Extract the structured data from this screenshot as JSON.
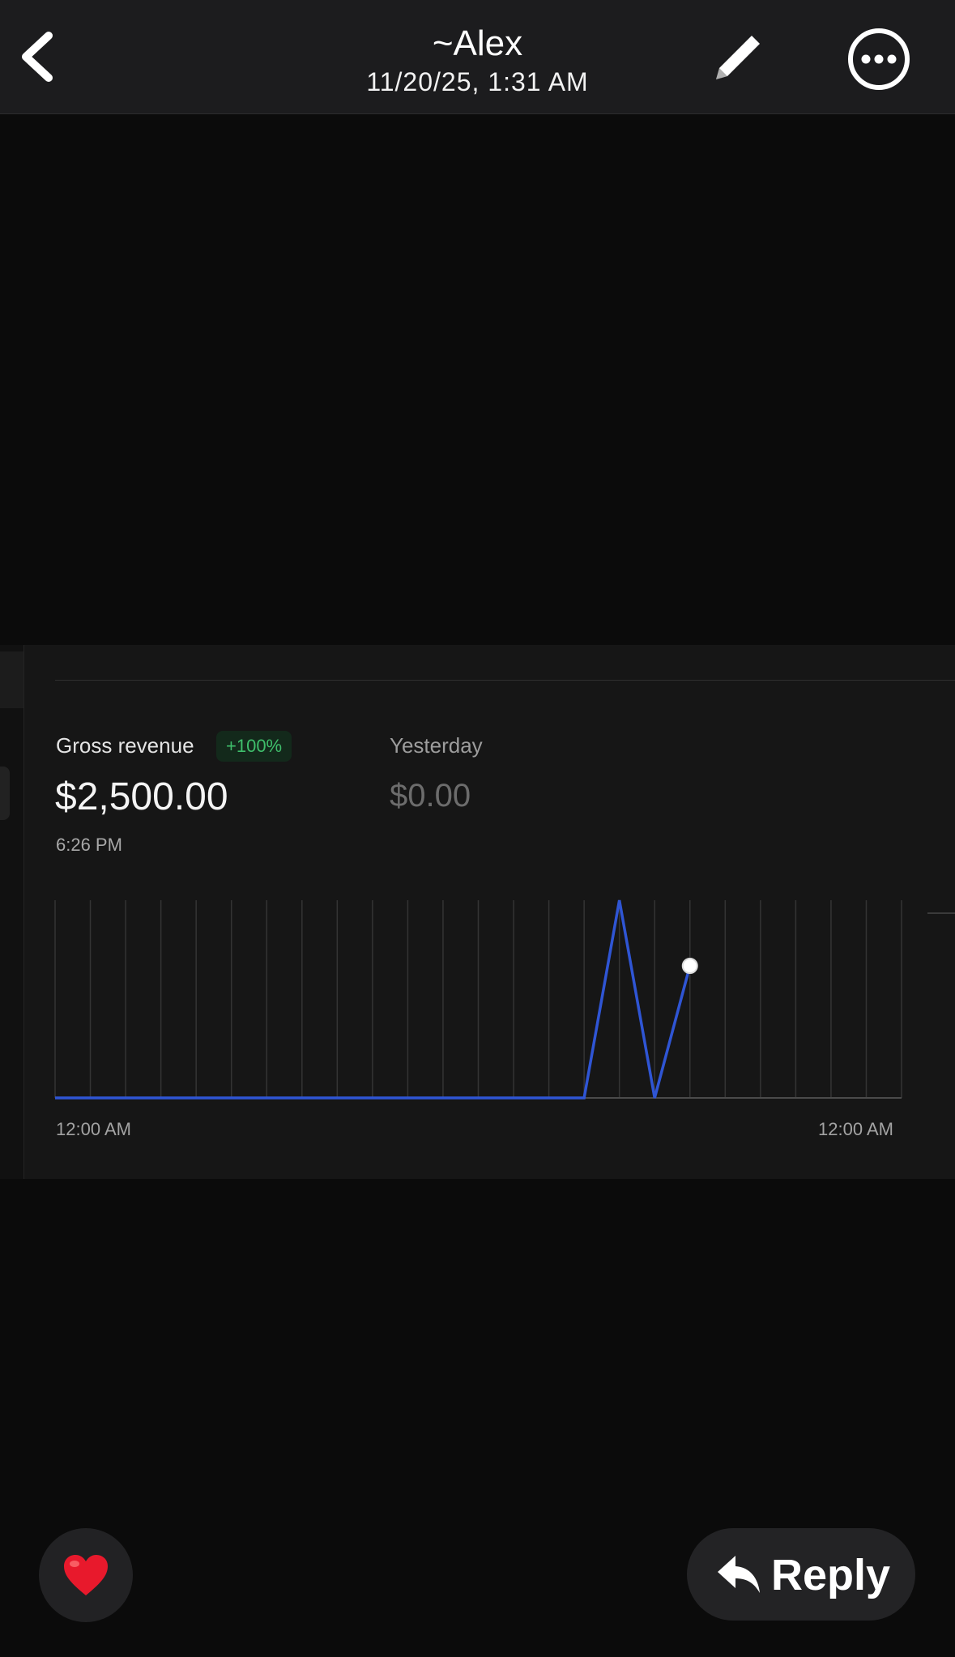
{
  "header": {
    "title": "~Alex",
    "timestamp": "11/20/25, 1:31 AM",
    "back_icon": "chevron-left-icon",
    "edit_icon": "pencil-icon",
    "more_icon": "ellipsis-circle-icon"
  },
  "dashboard": {
    "gross_label": "Gross revenue",
    "badge": "+100%",
    "gross_value": "$2,500.00",
    "time": "6:26 PM",
    "yesterday_label": "Yesterday",
    "yesterday_value": "$0.00",
    "colors": {
      "line": "#2f55d4",
      "badge_text": "#3fbe6b",
      "badge_bg": "#13291b"
    }
  },
  "chart_data": {
    "type": "line",
    "x_tick_labels": [
      "12:00 AM",
      "12:00 AM"
    ],
    "hours": [
      0,
      1,
      2,
      3,
      4,
      5,
      6,
      7,
      8,
      9,
      10,
      11,
      12,
      13,
      14,
      15,
      16,
      17,
      18
    ],
    "values": [
      0,
      0,
      0,
      0,
      0,
      0,
      0,
      0,
      0,
      0,
      0,
      0,
      0,
      0,
      0,
      0,
      2500,
      0,
      1670
    ],
    "highlight_index": 18,
    "x_range": [
      0,
      24
    ],
    "y_range": [
      0,
      2500
    ],
    "grid": "vertical",
    "gridlines": 25
  },
  "actions": {
    "like_icon": "heart-icon",
    "reply_icon": "reply-arrow-icon",
    "reply_label": "Reply"
  }
}
